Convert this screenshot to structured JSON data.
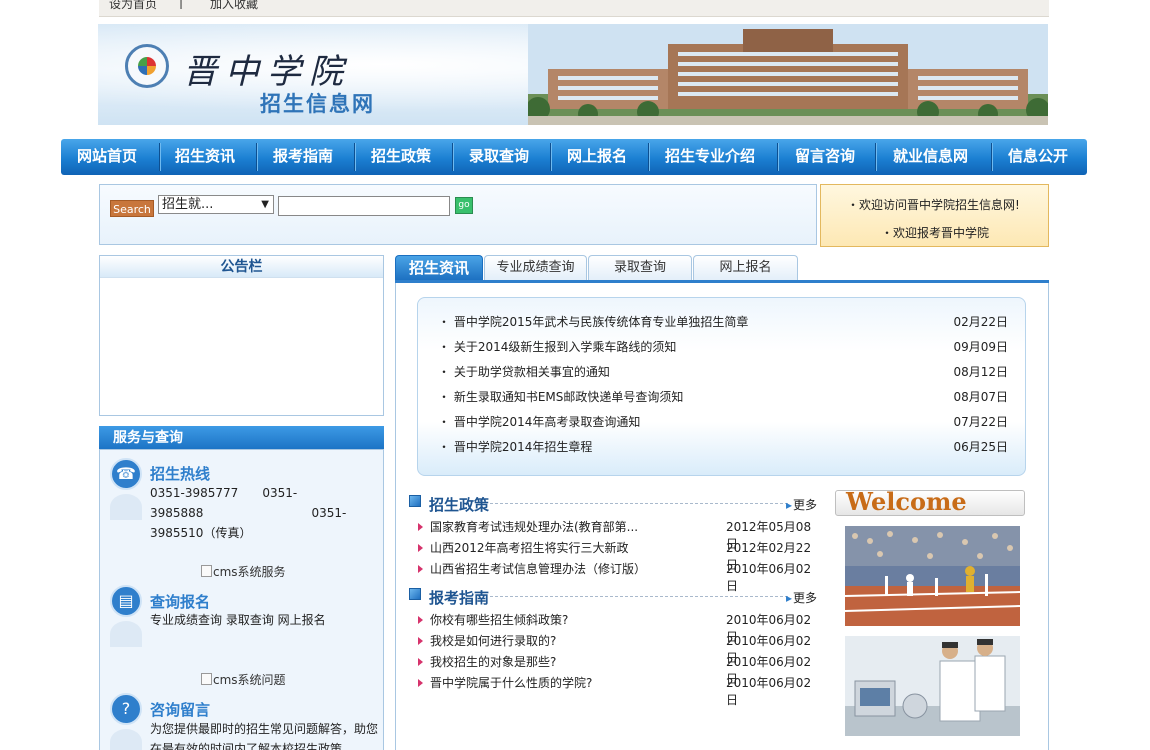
{
  "topbar": {
    "set_home": "设为首页",
    "divider": "|",
    "bookmark": "加入收藏"
  },
  "banner": {
    "school_name": "晋中学院",
    "site_name": "招生信息网"
  },
  "nav": {
    "items": [
      "网站首页",
      "招生资讯",
      "报考指南",
      "招生政策",
      "录取查询",
      "网上报名",
      "招生专业介绍",
      "留言咨询",
      "就业信息网",
      "信息公开"
    ]
  },
  "search": {
    "button": "Search",
    "select_value": "招生就...",
    "input_value": "",
    "go": "go"
  },
  "welcome_box": {
    "line1": "・欢迎访问晋中学院招生信息网!",
    "line2": "・欢迎报考晋中学院"
  },
  "notice": {
    "title": "公告栏"
  },
  "service": {
    "title": "服务与查询",
    "hotline_title": "招生热线",
    "hotline_line1": "0351-3985777　　0351-",
    "hotline_line2": "3985888　　　　　　　　　0351-",
    "hotline_line3": "3985510（传真）",
    "img1_alt": "cms系统服务",
    "query_title": "查询报名",
    "query_text": "专业成绩查询 录取查询 网上报名",
    "img2_alt": "cms系统问题",
    "consult_title": "咨询留言",
    "consult_text1": "为您提供最即时的招生常见问题解答，助您",
    "consult_text2": "在最有效的时间内了解本校招生政策。"
  },
  "tabs": [
    "招生资讯",
    "专业成绩查询",
    "录取查询",
    "网上报名"
  ],
  "news": [
    {
      "title": "・ 晋中学院2015年武术与民族传统体育专业单独招生简章",
      "date": "02月22日"
    },
    {
      "title": "・ 关于2014级新生报到入学乘车路线的须知",
      "date": "09月09日"
    },
    {
      "title": "・ 关于助学贷款相关事宜的通知",
      "date": "08月12日"
    },
    {
      "title": "・ 新生录取通知书EMS邮政快递单号查询须知",
      "date": "08月07日"
    },
    {
      "title": "・ 晋中学院2014年高考录取查询通知",
      "date": "07月22日"
    },
    {
      "title": "・ 晋中学院2014年招生章程",
      "date": "06月25日"
    }
  ],
  "policy": {
    "title": "招生政策",
    "more": "更多",
    "items": [
      {
        "title": "国家教育考试违规处理办法(教育部第...",
        "date": "2012年05月08日"
      },
      {
        "title": "山西2012年高考招生将实行三大新政",
        "date": "2012年02月22日"
      },
      {
        "title": "山西省招生考试信息管理办法（修订版）",
        "date": "2010年06月02日"
      }
    ]
  },
  "guide": {
    "title": "报考指南",
    "more": "更多",
    "items": [
      {
        "title": "你校有哪些招生倾斜政策?",
        "date": "2010年06月02日"
      },
      {
        "title": "我校是如何进行录取的?",
        "date": "2010年06月02日"
      },
      {
        "title": "我校招生的对象是那些?",
        "date": "2010年06月02日"
      },
      {
        "title": "晋中学院属于什么性质的学院?",
        "date": "2010年06月02日"
      }
    ]
  },
  "welcome": {
    "title": "Welcome"
  },
  "colors": {
    "nav_blue": "#1b7fd2",
    "title_blue": "#1f5591",
    "accent_orange": "#c8763c",
    "welcome_orange": "#c86c18"
  }
}
